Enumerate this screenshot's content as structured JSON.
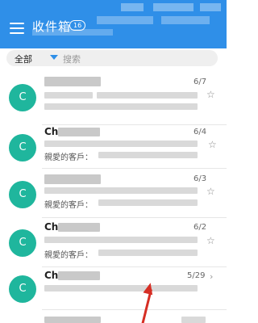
{
  "header": {
    "title": "收件箱",
    "unread_count": "16"
  },
  "search": {
    "filter_label": "全部",
    "placeholder": "搜索"
  },
  "messages": [
    {
      "avatar": "C",
      "sender": "",
      "date": "6/7",
      "preview": ""
    },
    {
      "avatar": "C",
      "sender": "Ch",
      "date": "6/4",
      "preview": "親愛的客戶："
    },
    {
      "avatar": "C",
      "sender": "",
      "date": "6/3",
      "preview": "親愛的客戶："
    },
    {
      "avatar": "C",
      "sender": "Ch",
      "date": "6/2",
      "preview": "親愛的客戶："
    },
    {
      "avatar": "C",
      "sender": "Ch",
      "date": "5/29",
      "preview": ""
    }
  ],
  "colors": {
    "header": "#2f8fe8",
    "avatar": "#1fb69d",
    "annotation_arrow": "#d62e24"
  },
  "icons": [
    "menu-icon",
    "dropdown-caret-icon",
    "star-icon",
    "chevron-right-icon"
  ]
}
